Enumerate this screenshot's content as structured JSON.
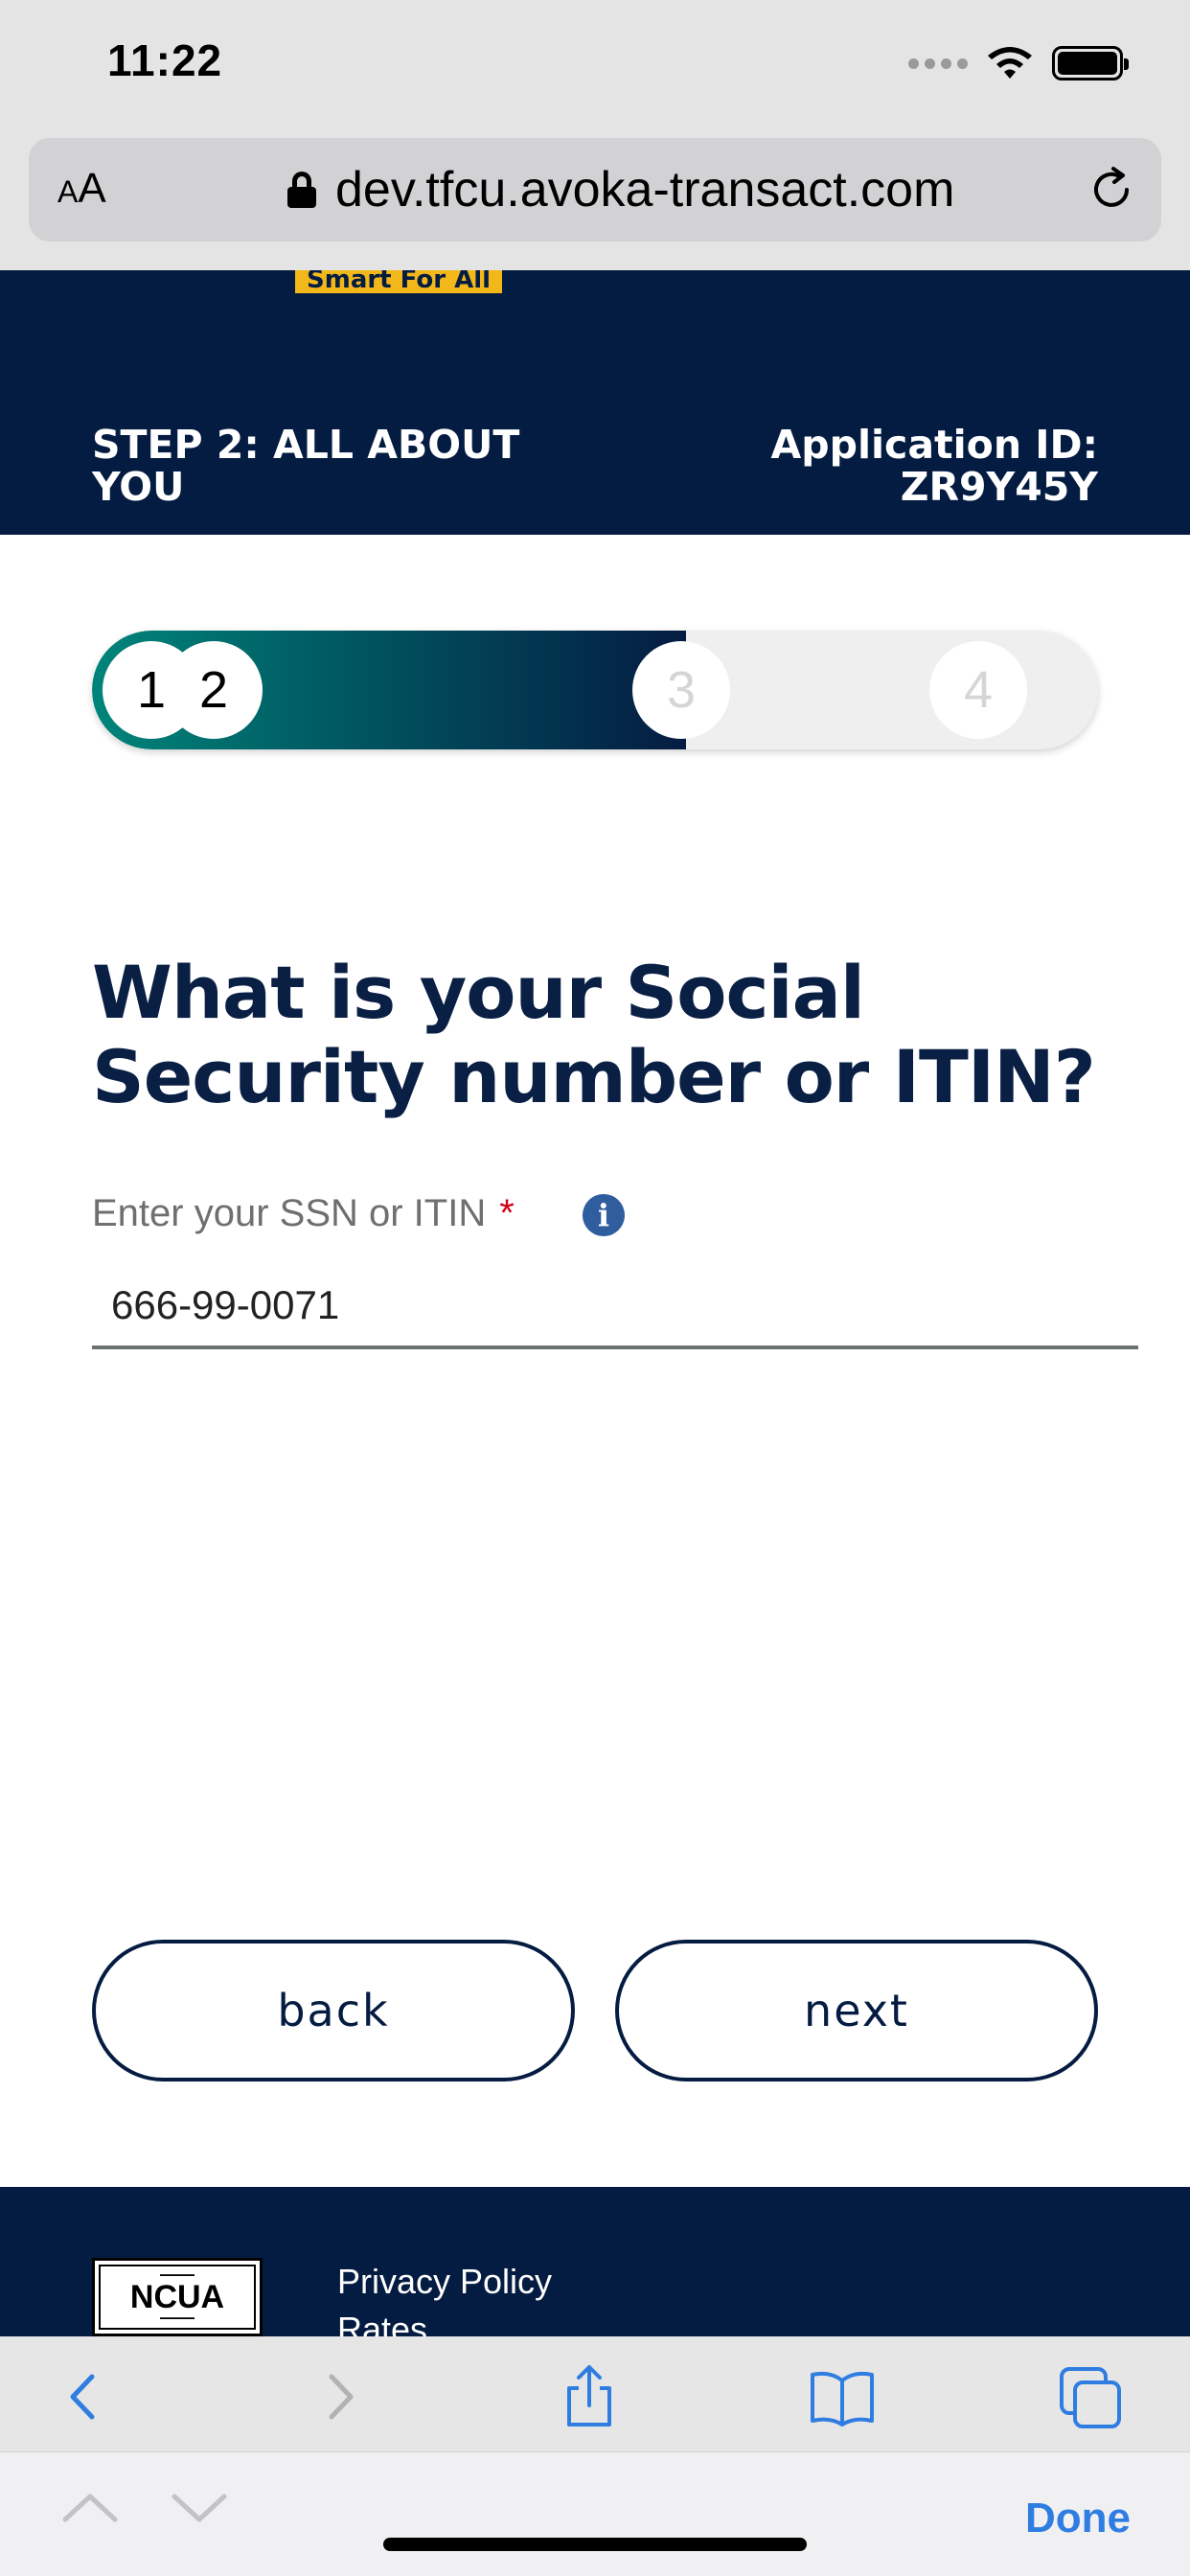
{
  "status_bar": {
    "time": "11:22"
  },
  "browser": {
    "text_size_label_small": "A",
    "text_size_label_large": "A",
    "url": "dev.tfcu.avoka-transact.com"
  },
  "header": {
    "tagline": "Smart For All",
    "step_label": "STEP 2: ALL ABOUT YOU",
    "application_id_label": "Application ID:",
    "application_id": "ZR9Y45Y"
  },
  "progress": {
    "steps": [
      "1",
      "2",
      "3",
      "4"
    ],
    "current_step": 2,
    "total_steps": 4,
    "fill_fraction": 0.59
  },
  "form": {
    "question": "What is your Social Security number or ITIN?",
    "ssn_label": "Enter your SSN or ITIN",
    "required_marker": "*",
    "ssn_value": "666-99-0071"
  },
  "actions": {
    "back_label": "back",
    "next_label": "next"
  },
  "footer": {
    "ncua_logo_text": "NCUA",
    "links": [
      "Privacy Policy",
      "Rates"
    ]
  },
  "keyboard_toolbar": {
    "done_label": "Done"
  },
  "colors": {
    "navy": "#051c42",
    "teal": "#00857a",
    "accent_yellow": "#f2b81a",
    "link_blue": "#2f7de1"
  }
}
